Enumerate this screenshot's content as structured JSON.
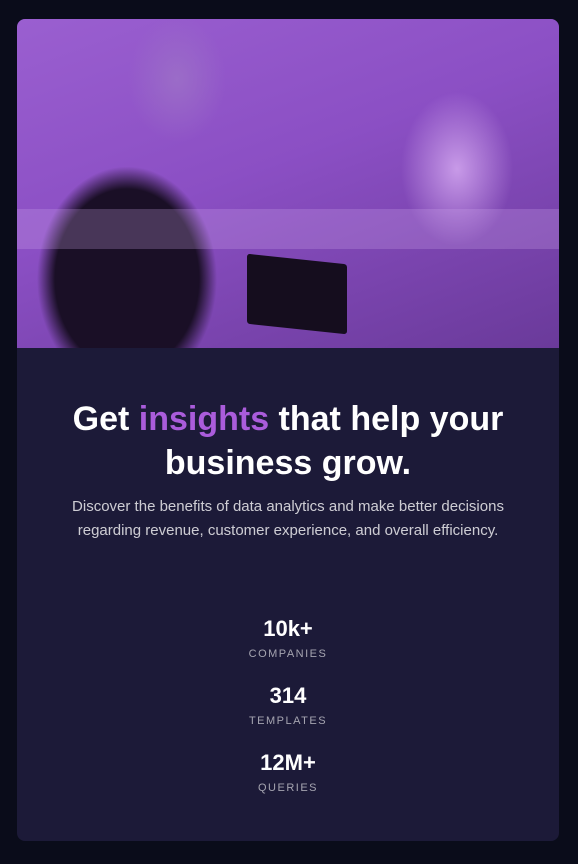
{
  "card": {
    "image_alt": "Team working in office",
    "title_pre": "Get ",
    "title_accent": "insights",
    "title_post": " that help your business grow.",
    "description": "Discover the benefits of data analytics and make better decisions regarding revenue, customer experience, and overall efficiency.",
    "accent_color": "#aa5cdb",
    "stats": [
      {
        "value": "10k+",
        "label": "COMPANIES"
      },
      {
        "value": "314",
        "label": "TEMPLATES"
      },
      {
        "value": "12M+",
        "label": "QUERIES"
      }
    ]
  }
}
